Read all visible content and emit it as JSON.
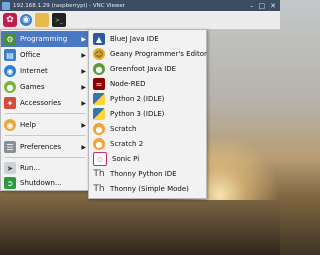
{
  "window": {
    "title": "192.168.1.29 (raspberrypi) - VNC Viewer",
    "buttons": [
      "minimize",
      "maximize",
      "close"
    ]
  },
  "panel": {
    "icons": [
      "raspberry-pi-menu-icon",
      "web-browser-icon",
      "file-manager-icon",
      "terminal-icon"
    ]
  },
  "main_menu": {
    "items": [
      {
        "label": "Programming",
        "icon": "programming-icon",
        "has_submenu": true,
        "active": true
      },
      {
        "label": "Office",
        "icon": "office-icon",
        "has_submenu": true
      },
      {
        "label": "Internet",
        "icon": "internet-icon",
        "has_submenu": true
      },
      {
        "label": "Games",
        "icon": "games-icon",
        "has_submenu": true
      },
      {
        "label": "Accessories",
        "icon": "accessories-icon",
        "has_submenu": true
      },
      {
        "label": "Help",
        "icon": "help-icon",
        "has_submenu": true
      },
      {
        "label": "Preferences",
        "icon": "preferences-icon",
        "has_submenu": true
      },
      {
        "label": "Run...",
        "icon": "run-icon",
        "has_submenu": false
      },
      {
        "label": "Shutdown...",
        "icon": "shutdown-icon",
        "has_submenu": false
      }
    ]
  },
  "sub_menu": {
    "items": [
      {
        "label": "BlueJ Java IDE",
        "icon": "bluej-icon"
      },
      {
        "label": "Geany Programmer's Editor",
        "icon": "geany-icon"
      },
      {
        "label": "Greenfoot Java IDE",
        "icon": "greenfoot-icon"
      },
      {
        "label": "Node-RED",
        "icon": "node-red-icon"
      },
      {
        "label": "Python 2 (IDLE)",
        "icon": "python-icon"
      },
      {
        "label": "Python 3 (IDLE)",
        "icon": "python-icon"
      },
      {
        "label": "Scratch",
        "icon": "scratch-icon"
      },
      {
        "label": "Scratch 2",
        "icon": "scratch-icon"
      },
      {
        "label": "Sonic Pi",
        "icon": "sonic-pi-icon"
      },
      {
        "label": "Thonny Python IDE",
        "icon": "thonny-icon"
      },
      {
        "label": "Thonny (Simple Mode)",
        "icon": "thonny-icon"
      }
    ]
  },
  "colors": {
    "highlight": "#4a78c2",
    "menu_bg": "#f2f2f2",
    "titlebar": "#3c4c63",
    "rpi_red": "#c51a4a"
  }
}
